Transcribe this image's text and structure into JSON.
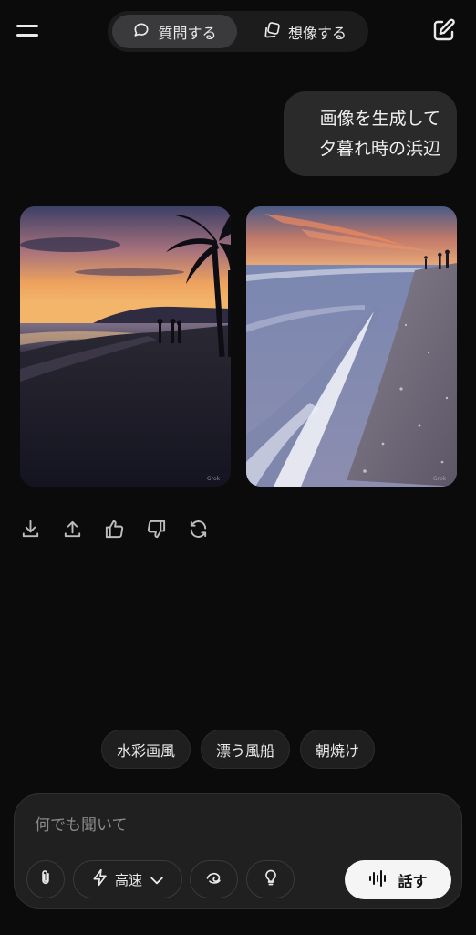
{
  "header": {
    "mode_ask_label": "質問する",
    "mode_imagine_label": "想像する"
  },
  "user_message": {
    "line1": "画像を生成して",
    "line2": "夕暮れ時の浜辺"
  },
  "images": [
    {
      "watermark": "Grok"
    },
    {
      "watermark": "Grok"
    }
  ],
  "suggestions": [
    "水彩画風",
    "漂う風船",
    "朝焼け"
  ],
  "composer": {
    "placeholder": "何でも聞いて",
    "model_label": "高速",
    "talk_label": "話す"
  },
  "icons": {
    "menu": "menu-icon",
    "ask": "chat-bubble-icon",
    "imagine": "image-stack-icon",
    "new_chat": "edit-icon",
    "download": "download-icon",
    "share": "share-icon",
    "like": "thumbs-up-icon",
    "dislike": "thumbs-down-icon",
    "regenerate": "refresh-icon",
    "attach": "paperclip-icon",
    "model": "lightning-icon",
    "deep": "swirl-icon",
    "think": "lightbulb-icon",
    "talk": "audio-wave-icon"
  },
  "colors": {
    "background": "#0b0b0b",
    "surface": "#202020",
    "bubble": "#2a2a2a",
    "talk_button": "#f5f5f5"
  }
}
